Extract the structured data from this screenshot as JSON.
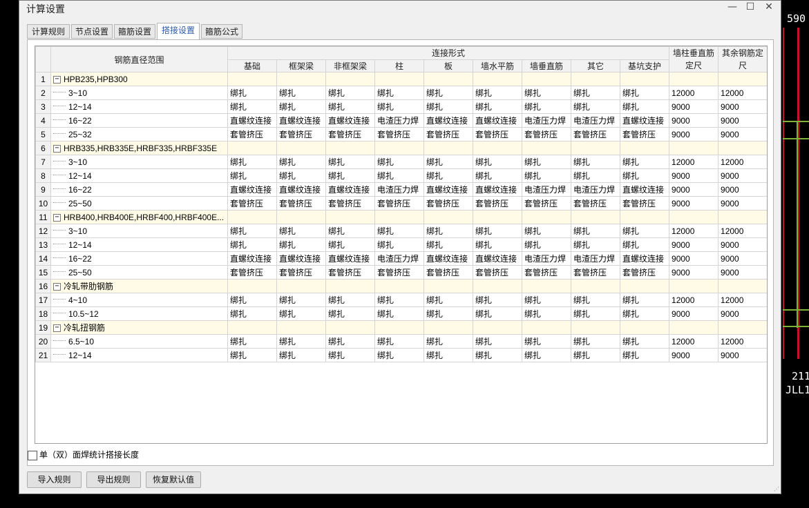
{
  "window": {
    "title": "计算设置"
  },
  "background": {
    "cad_text_top": "590",
    "cad_text_mid": "211",
    "cad_text_bottom": "JLL1"
  },
  "tabs": [
    {
      "label": "计算规则"
    },
    {
      "label": "节点设置"
    },
    {
      "label": "箍筋设置"
    },
    {
      "label": "搭接设置",
      "active": true
    },
    {
      "label": "箍筋公式"
    }
  ],
  "table": {
    "header": {
      "diameter_range": "钢筋直径范围",
      "connection_type": "连接形式",
      "wall_column_vertical": "墙柱垂直筋定尺",
      "other_rebar": "其余钢筋定尺",
      "columns": [
        "基础",
        "框架梁",
        "非框架梁",
        "柱",
        "板",
        "墙水平筋",
        "墙垂直筋",
        "其它",
        "基坑支护"
      ]
    },
    "rows": [
      {
        "num": "1",
        "group": true,
        "label": "HPB235,HPB300"
      },
      {
        "num": "2",
        "label": "3~10",
        "cells": [
          "绑扎",
          "绑扎",
          "绑扎",
          "绑扎",
          "绑扎",
          "绑扎",
          "绑扎",
          "绑扎",
          "绑扎",
          "12000",
          "12000"
        ]
      },
      {
        "num": "3",
        "label": "12~14",
        "cells": [
          "绑扎",
          "绑扎",
          "绑扎",
          "绑扎",
          "绑扎",
          "绑扎",
          "绑扎",
          "绑扎",
          "绑扎",
          "9000",
          "9000"
        ]
      },
      {
        "num": "4",
        "label": "16~22",
        "cells": [
          "直螺纹连接",
          "直螺纹连接",
          "直螺纹连接",
          "电渣压力焊",
          "直螺纹连接",
          "直螺纹连接",
          "电渣压力焊",
          "电渣压力焊",
          "直螺纹连接",
          "9000",
          "9000"
        ]
      },
      {
        "num": "5",
        "label": "25~32",
        "cells": [
          "套管挤压",
          "套管挤压",
          "套管挤压",
          "套管挤压",
          "套管挤压",
          "套管挤压",
          "套管挤压",
          "套管挤压",
          "套管挤压",
          "9000",
          "9000"
        ]
      },
      {
        "num": "6",
        "group": true,
        "label": "HRB335,HRB335E,HRBF335,HRBF335E"
      },
      {
        "num": "7",
        "label": "3~10",
        "cells": [
          "绑扎",
          "绑扎",
          "绑扎",
          "绑扎",
          "绑扎",
          "绑扎",
          "绑扎",
          "绑扎",
          "绑扎",
          "12000",
          "12000"
        ]
      },
      {
        "num": "8",
        "label": "12~14",
        "cells": [
          "绑扎",
          "绑扎",
          "绑扎",
          "绑扎",
          "绑扎",
          "绑扎",
          "绑扎",
          "绑扎",
          "绑扎",
          "9000",
          "9000"
        ]
      },
      {
        "num": "9",
        "label": "16~22",
        "cells": [
          "直螺纹连接",
          "直螺纹连接",
          "直螺纹连接",
          "电渣压力焊",
          "直螺纹连接",
          "直螺纹连接",
          "电渣压力焊",
          "电渣压力焊",
          "直螺纹连接",
          "9000",
          "9000"
        ]
      },
      {
        "num": "10",
        "label": "25~50",
        "cells": [
          "套管挤压",
          "套管挤压",
          "套管挤压",
          "套管挤压",
          "套管挤压",
          "套管挤压",
          "套管挤压",
          "套管挤压",
          "套管挤压",
          "9000",
          "9000"
        ]
      },
      {
        "num": "11",
        "group": true,
        "label": "HRB400,HRB400E,HRBF400,HRBF400E..."
      },
      {
        "num": "12",
        "label": "3~10",
        "cells": [
          "绑扎",
          "绑扎",
          "绑扎",
          "绑扎",
          "绑扎",
          "绑扎",
          "绑扎",
          "绑扎",
          "绑扎",
          "12000",
          "12000"
        ]
      },
      {
        "num": "13",
        "label": "12~14",
        "cells": [
          "绑扎",
          "绑扎",
          "绑扎",
          "绑扎",
          "绑扎",
          "绑扎",
          "绑扎",
          "绑扎",
          "绑扎",
          "9000",
          "9000"
        ]
      },
      {
        "num": "14",
        "label": "16~22",
        "cells": [
          "直螺纹连接",
          "直螺纹连接",
          "直螺纹连接",
          "电渣压力焊",
          "直螺纹连接",
          "直螺纹连接",
          "电渣压力焊",
          "电渣压力焊",
          "直螺纹连接",
          "9000",
          "9000"
        ]
      },
      {
        "num": "15",
        "label": "25~50",
        "cells": [
          "套管挤压",
          "套管挤压",
          "套管挤压",
          "套管挤压",
          "套管挤压",
          "套管挤压",
          "套管挤压",
          "套管挤压",
          "套管挤压",
          "9000",
          "9000"
        ]
      },
      {
        "num": "16",
        "group": true,
        "label": "冷轧带肋钢筋"
      },
      {
        "num": "17",
        "label": "4~10",
        "cells": [
          "绑扎",
          "绑扎",
          "绑扎",
          "绑扎",
          "绑扎",
          "绑扎",
          "绑扎",
          "绑扎",
          "绑扎",
          "12000",
          "12000"
        ]
      },
      {
        "num": "18",
        "label": "10.5~12",
        "cells": [
          "绑扎",
          "绑扎",
          "绑扎",
          "绑扎",
          "绑扎",
          "绑扎",
          "绑扎",
          "绑扎",
          "绑扎",
          "9000",
          "9000"
        ]
      },
      {
        "num": "19",
        "group": true,
        "label": "冷轧扭钢筋"
      },
      {
        "num": "20",
        "label": "6.5~10",
        "cells": [
          "绑扎",
          "绑扎",
          "绑扎",
          "绑扎",
          "绑扎",
          "绑扎",
          "绑扎",
          "绑扎",
          "绑扎",
          "12000",
          "12000"
        ]
      },
      {
        "num": "21",
        "label": "12~14",
        "cells": [
          "绑扎",
          "绑扎",
          "绑扎",
          "绑扎",
          "绑扎",
          "绑扎",
          "绑扎",
          "绑扎",
          "绑扎",
          "9000",
          "9000"
        ]
      }
    ]
  },
  "checkbox": {
    "label": "单（双）面焊统计搭接长度",
    "checked": false
  },
  "buttons": {
    "import": "导入规则",
    "export": "导出规则",
    "restore": "恢复默认值"
  },
  "icons": {
    "minimize": "minimize-icon",
    "maximize": "maximize-icon",
    "close": "close-icon",
    "collapse": "collapse-icon"
  }
}
